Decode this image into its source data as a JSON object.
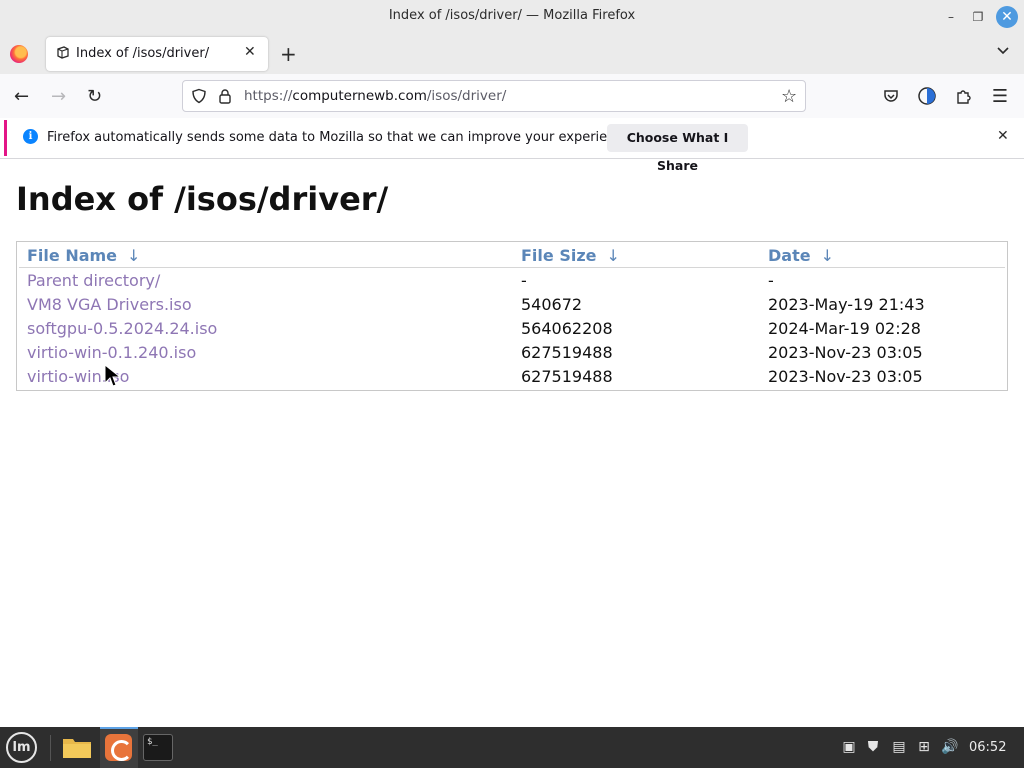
{
  "window": {
    "title": "Index of /isos/driver/ — Mozilla Firefox",
    "controls": {
      "minimize": "–",
      "maximize": "❐",
      "close": "✕"
    }
  },
  "tabs": [
    {
      "label": "Index of /isos/driver/",
      "close": "✕",
      "active": true
    }
  ],
  "tabstrip": {
    "new_tab": "+",
    "list_all": "⌄"
  },
  "navbar": {
    "back": "←",
    "forward": "→",
    "reload": "↻",
    "url_scheme": "https://",
    "url_host": "computernewb.com",
    "url_path": "/isos/driver/",
    "bookmark": "☆",
    "menu": "☰"
  },
  "notification": {
    "message": "Firefox automatically sends some data to Mozilla so that we can improve your experience.",
    "button": "Choose What I Share",
    "close": "✕",
    "info_glyph": "i"
  },
  "page": {
    "heading": "Index of /isos/driver/",
    "columns": [
      {
        "label": "File Name",
        "arrow": "↓"
      },
      {
        "label": "File Size",
        "arrow": "↓"
      },
      {
        "label": "Date",
        "arrow": "↓"
      }
    ],
    "rows": [
      {
        "name": "Parent directory/",
        "size": "-",
        "date": "-"
      },
      {
        "name": "VM8 VGA Drivers.iso",
        "size": "540672",
        "date": "2023-May-19 21:43"
      },
      {
        "name": "softgpu-0.5.2024.24.iso",
        "size": "564062208",
        "date": "2024-Mar-19 02:28"
      },
      {
        "name": "virtio-win-0.1.240.iso",
        "size": "627519488",
        "date": "2023-Nov-23 03:05"
      },
      {
        "name": "virtio-win.iso",
        "size": "627519488",
        "date": "2023-Nov-23 03:05"
      }
    ],
    "link_color": "#8e76b4",
    "header_color": "#5b86b8"
  },
  "taskbar": {
    "menu_glyph": "lm",
    "terminal_glyph": "$_",
    "clock": "06:52",
    "tray_glyphs": {
      "clipboard": "▣",
      "shield": "⛊",
      "updates": "▤",
      "network": "⊞",
      "volume": "🔊"
    }
  }
}
